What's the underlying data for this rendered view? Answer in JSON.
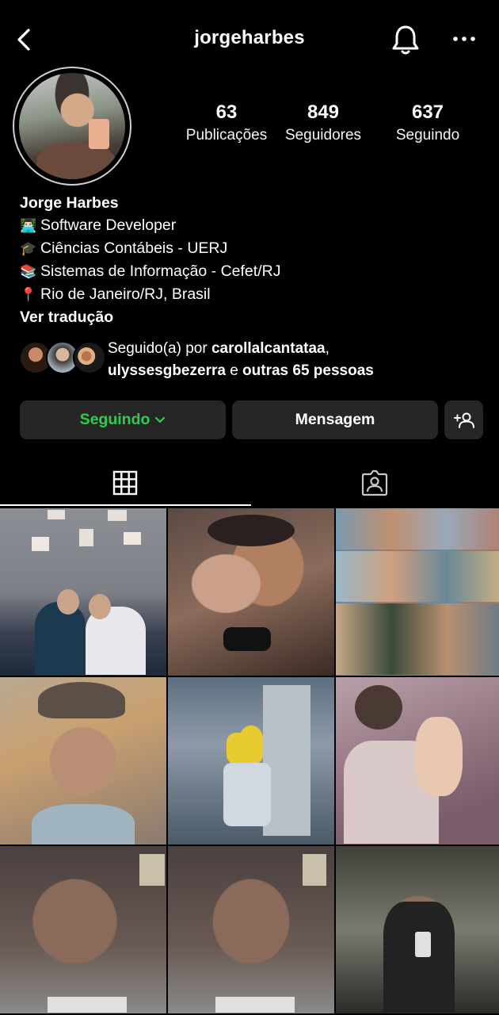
{
  "header": {
    "username": "jorgeharbes",
    "back_icon": "chevron-left-icon",
    "notifications_icon": "bell-icon",
    "more_icon": "more-horizontal-icon"
  },
  "stats": {
    "posts": {
      "value": "63",
      "label": "Publicações"
    },
    "followers": {
      "value": "849",
      "label": "Seguidores"
    },
    "following": {
      "value": "637",
      "label": "Seguindo"
    }
  },
  "bio": {
    "name": "Jorge Harbes",
    "lines": [
      {
        "emoji": "👨🏻‍💻",
        "text": "Software Developer"
      },
      {
        "emoji": "🎓",
        "text": "Ciências Contábeis - UERJ"
      },
      {
        "emoji": "📚",
        "text": "Sistemas de Informação - Cefet/RJ"
      },
      {
        "emoji": "📍",
        "text": "Rio de Janeiro/RJ, Brasil"
      }
    ],
    "translate": "Ver tradução"
  },
  "followed_by": {
    "prefix": "Seguido(a) por ",
    "user1": "carollalcantataa",
    "comma": ",",
    "user2": "ulyssesgbezerra",
    "connector": " e ",
    "others": "outras 65 pessoas"
  },
  "actions": {
    "following_label": "Seguindo",
    "following_chevron": "⌄",
    "message_label": "Mensagem",
    "add_user_icon": "add-user-icon"
  },
  "tabs": [
    {
      "name": "grid",
      "icon": "grid-icon",
      "active": true
    },
    {
      "name": "tagged",
      "icon": "tagged-person-icon",
      "active": false
    }
  ],
  "colors": {
    "background": "#000000",
    "button_bg": "#262626",
    "following_green": "#2ecc4d"
  }
}
